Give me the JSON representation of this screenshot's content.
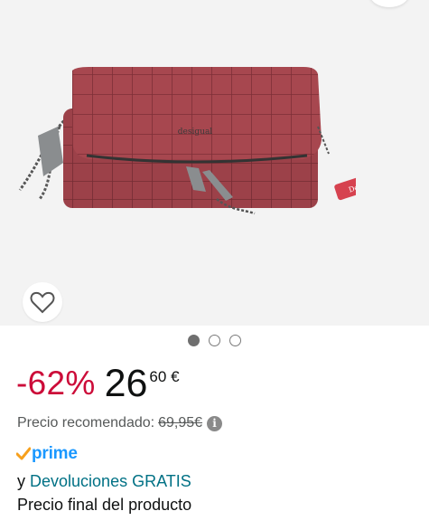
{
  "gallery": {
    "total_images": 3,
    "active_index": 0,
    "brand_tag_text": "Desigual",
    "flap_logo_text": "desigual"
  },
  "price": {
    "discount": "-62%",
    "whole": "26",
    "cents": "60",
    "currency": "€"
  },
  "list_price": {
    "label": "Precio recomendado:",
    "value": "69,95€",
    "info_icon": "i"
  },
  "prime": {
    "label": "prime"
  },
  "returns": {
    "prefix": "y",
    "link": "Devoluciones GRATIS"
  },
  "final_price_note": "Precio final del producto",
  "colors": {
    "discount": "#cc0c39",
    "link": "#007185",
    "prime_blue": "#1a98ff",
    "prime_check": "#f7a01c",
    "bag": "#a0444b"
  }
}
